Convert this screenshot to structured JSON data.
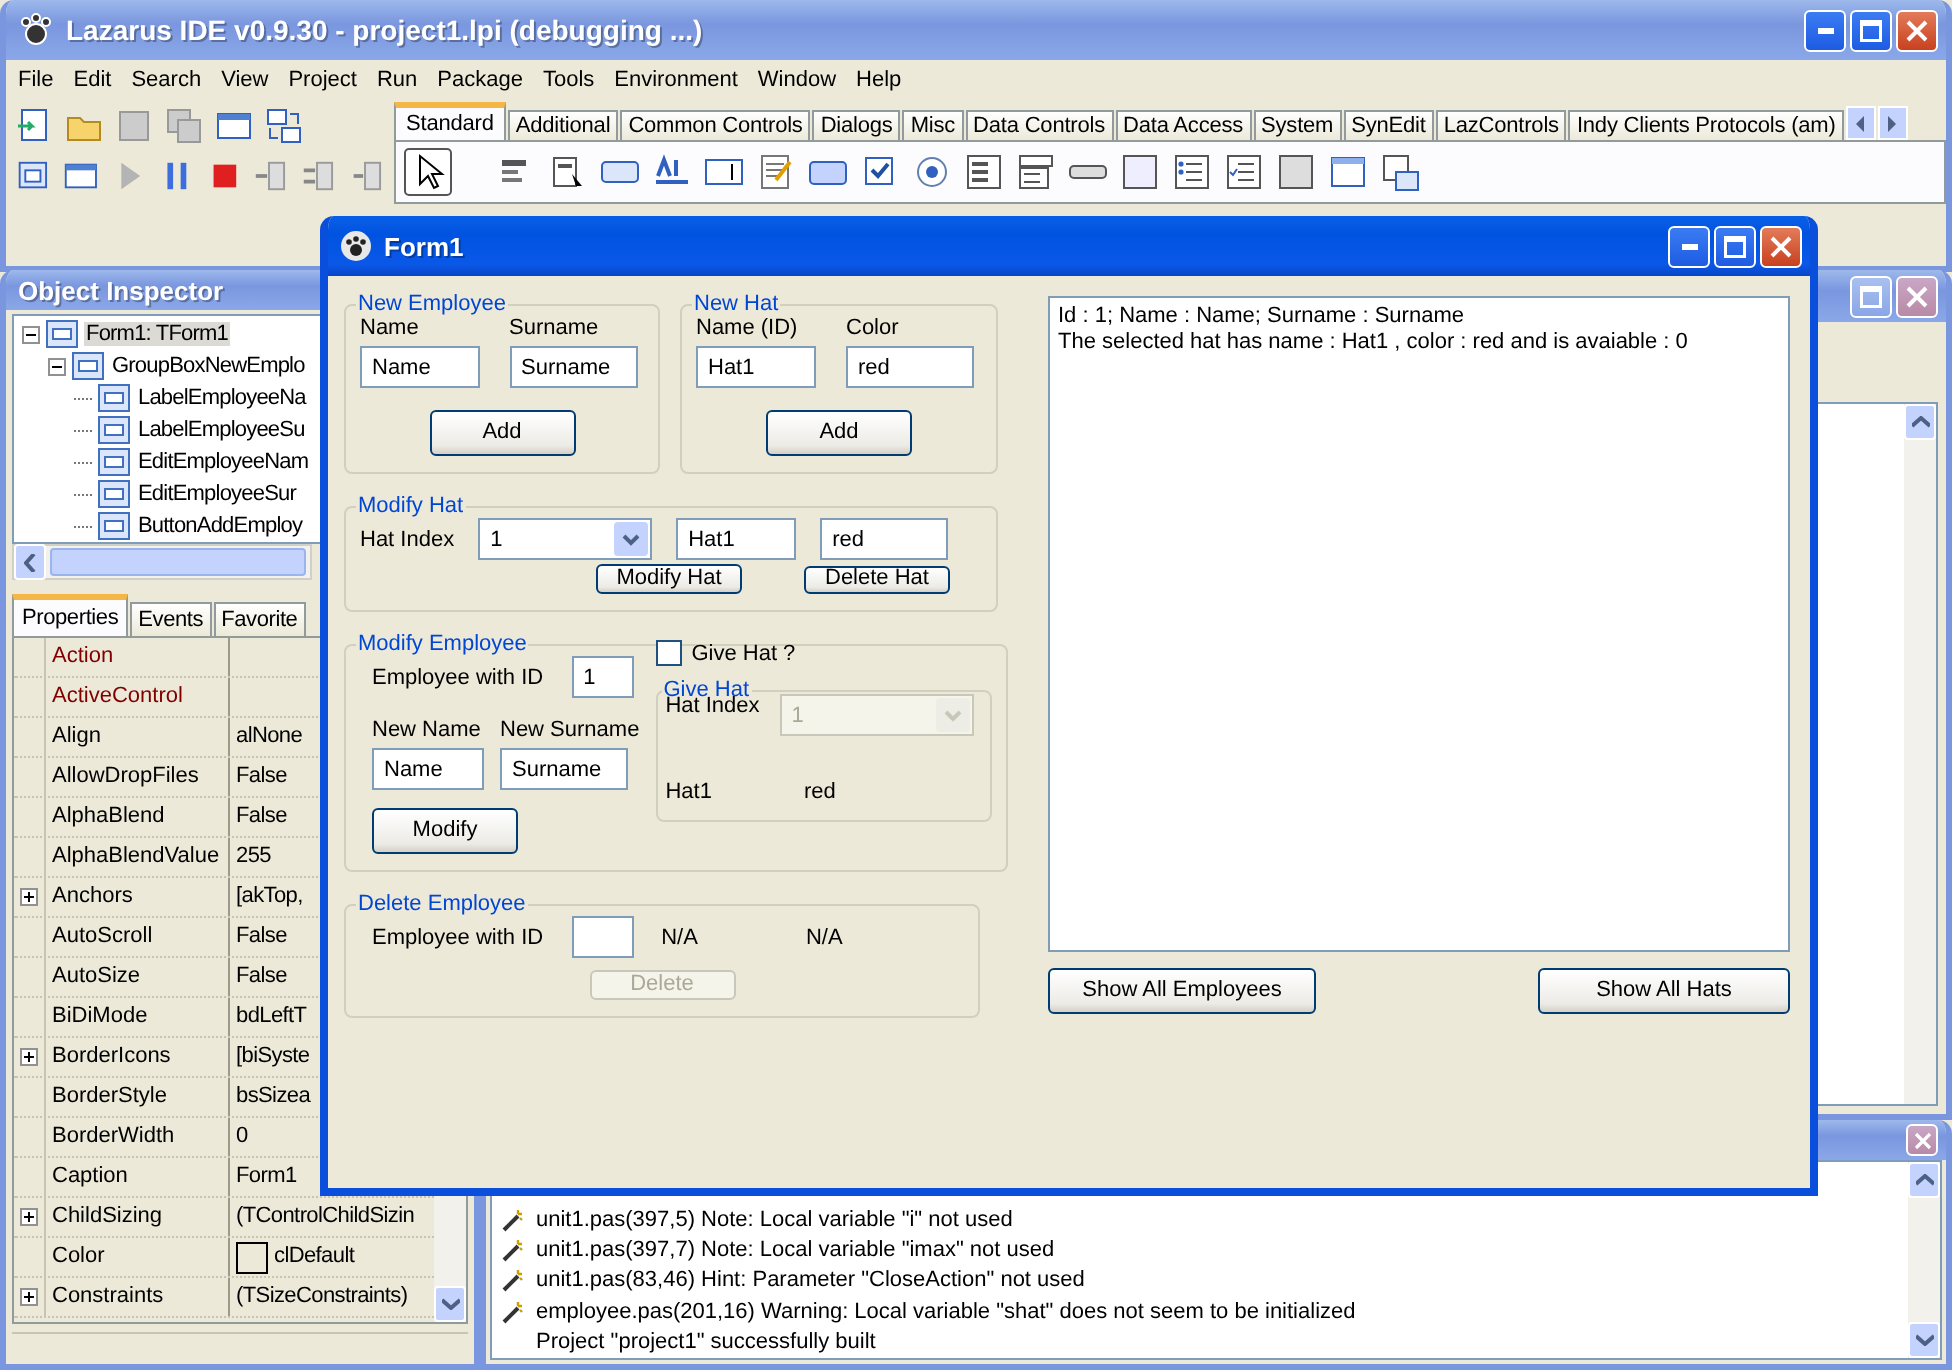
{
  "ide": {
    "title": "Lazarus IDE v0.9.30 - project1.lpi (debugging ...)",
    "menu": [
      "File",
      "Edit",
      "Search",
      "View",
      "Project",
      "Run",
      "Package",
      "Tools",
      "Environment",
      "Window",
      "Help"
    ],
    "palette_tabs": [
      {
        "label": "Standard",
        "selected": true
      },
      {
        "label": "Additional",
        "selected": false
      },
      {
        "label": "Common Controls",
        "selected": false
      },
      {
        "label": "Dialogs",
        "selected": false
      },
      {
        "label": "Misc",
        "selected": false
      },
      {
        "label": "Data Controls",
        "selected": false
      },
      {
        "label": "Data Access",
        "selected": false
      },
      {
        "label": "System",
        "selected": false
      },
      {
        "label": "SynEdit",
        "selected": false
      },
      {
        "label": "LazControls",
        "selected": false
      },
      {
        "label": "Indy Clients Protocols (am)",
        "selected": false
      }
    ]
  },
  "object_inspector": {
    "title": "Object Inspector",
    "tree": [
      {
        "label": "Form1: TForm1",
        "selected": true,
        "expanded": true,
        "children": [
          {
            "label": "GroupBoxNewEmplo",
            "selected": false,
            "expanded": true,
            "children": [
              {
                "label": "LabelEmployeeNa",
                "selected": false,
                "expanded": false
              },
              {
                "label": "LabelEmployeeSu",
                "selected": false,
                "expanded": false
              },
              {
                "label": "EditEmployeeNam",
                "selected": false,
                "expanded": false
              },
              {
                "label": "EditEmployeeSur",
                "selected": false,
                "expanded": false
              },
              {
                "label": "ButtonAddEmploy",
                "selected": false,
                "expanded": false
              }
            ]
          }
        ]
      }
    ],
    "tabs": [
      {
        "label": "Properties",
        "selected": true
      },
      {
        "label": "Events",
        "selected": false
      },
      {
        "label": "Favorite",
        "selected": false
      }
    ],
    "properties": [
      {
        "name": "Action",
        "kind": "reference",
        "expandable": false
      },
      {
        "name": "ActiveControl",
        "kind": "reference",
        "expandable": false
      },
      {
        "name": "Align",
        "value": "alNone",
        "kind": "plain",
        "expandable": false
      },
      {
        "name": "AllowDropFiles",
        "value": "False",
        "kind": "plain",
        "expandable": false
      },
      {
        "name": "AlphaBlend",
        "value": "False",
        "kind": "plain",
        "expandable": false
      },
      {
        "name": "AlphaBlendValue",
        "value": "255",
        "kind": "plain",
        "expandable": false
      },
      {
        "name": "Anchors",
        "value": "[akTop,",
        "kind": "plain",
        "expandable": true
      },
      {
        "name": "AutoScroll",
        "value": "False",
        "kind": "plain",
        "expandable": false
      },
      {
        "name": "AutoSize",
        "value": "False",
        "kind": "plain",
        "expandable": false
      },
      {
        "name": "BiDiMode",
        "value": "bdLeftT",
        "kind": "plain",
        "expandable": false
      },
      {
        "name": "BorderIcons",
        "value": "[biSyste",
        "kind": "plain",
        "expandable": true
      },
      {
        "name": "BorderStyle",
        "value": "bsSizea",
        "kind": "plain",
        "expandable": false
      },
      {
        "name": "BorderWidth",
        "value": "0",
        "kind": "plain",
        "expandable": false
      },
      {
        "name": "Caption",
        "value": "Form1",
        "kind": "plain",
        "expandable": false
      },
      {
        "name": "ChildSizing",
        "value": "(TControlChildSizin",
        "kind": "plain",
        "expandable": true
      },
      {
        "name": "Color",
        "value": "clDefault",
        "kind": "color",
        "expandable": false
      },
      {
        "name": "Constraints",
        "value": "(TSizeConstraints)",
        "kind": "plain",
        "expandable": true
      }
    ]
  },
  "messages": {
    "lines": [
      {
        "text": "unit1.pas(397,5) Note: Local variable \"i\" not used",
        "kind": "hint"
      },
      {
        "text": "unit1.pas(397,7) Note: Local variable \"imax\" not used",
        "kind": "hint"
      },
      {
        "text": "unit1.pas(83,46) Hint: Parameter \"CloseAction\" not used",
        "kind": "hint"
      },
      {
        "text": "employee.pas(201,16) Warning: Local variable \"shat\" does not seem to be initialized",
        "kind": "hint"
      },
      {
        "text": "Project \"project1\" successfully built",
        "kind": "info"
      }
    ]
  },
  "form": {
    "title": "Form1",
    "new_employee": {
      "caption": "New Employee",
      "labels": [
        "Name",
        "Surname"
      ],
      "fields": [
        "Name",
        "Surname"
      ],
      "button": "Add"
    },
    "new_hat": {
      "caption": "New Hat",
      "labels": [
        "Name (ID)",
        "Color"
      ],
      "fields": [
        "Hat1",
        "red"
      ],
      "button": "Add"
    },
    "modify_hat": {
      "caption": "Modify Hat",
      "label": "Hat Index",
      "combo": "1",
      "fields": [
        "Hat1",
        "red"
      ],
      "buttons": [
        "Modify Hat",
        "Delete Hat"
      ]
    },
    "modify_employee": {
      "caption": "Modify Employee",
      "id_label": "Employee with ID",
      "id_value": "1",
      "labels": [
        "New Name",
        "New Surname"
      ],
      "fields": [
        "Name",
        "Surname"
      ],
      "button": "Modify",
      "give_hat_check": {
        "label": "Give Hat ?",
        "checked": false
      },
      "give_hat": {
        "caption": "Give Hat",
        "label": "Hat Index",
        "combo": "1",
        "combo_disabled": true,
        "hat_name": "Hat1",
        "hat_color": "red"
      }
    },
    "delete_employee": {
      "caption": "Delete Employee",
      "id_label": "Employee with ID",
      "name": "N/A",
      "surname": "N/A",
      "button": "Delete",
      "button_disabled": true
    },
    "output": [
      "Id : 1; Name : Name; Surname : Surname",
      "The selected hat has name : Hat1 , color : red and is avaiable : 0"
    ],
    "buttons": [
      "Show All Employees",
      "Show All Hats"
    ]
  }
}
